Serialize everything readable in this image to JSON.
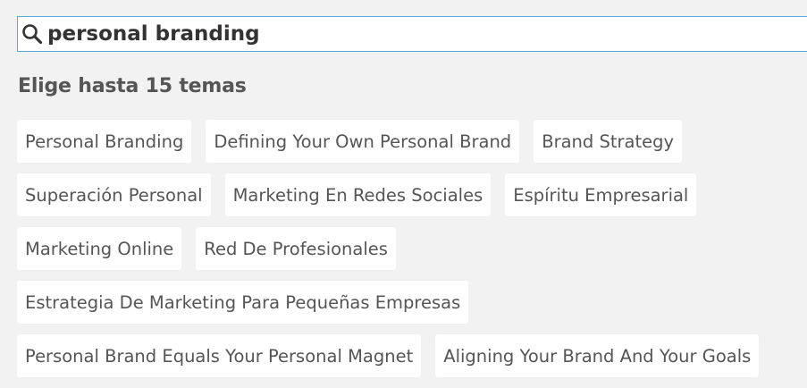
{
  "search": {
    "value": "personal branding",
    "icon": "search-icon"
  },
  "section_title": "Elige hasta 15 temas",
  "topic_rows": [
    [
      "Personal Branding",
      "Defining Your Own Personal Brand",
      "Brand Strategy"
    ],
    [
      "Superación Personal",
      "Marketing En Redes Sociales",
      "Espíritu Empresarial"
    ],
    [
      "Marketing Online",
      "Red De Profesionales"
    ],
    [
      "Estrategia De Marketing Para Pequeñas Empresas"
    ],
    [
      "Personal Brand Equals Your Personal Magnet",
      "Aligning Your Brand And Your Goals"
    ]
  ],
  "colors": {
    "background": "#f2f2f2",
    "chip_background": "#ffffff",
    "text": "#555555",
    "search_border": "#5aa8d6"
  }
}
